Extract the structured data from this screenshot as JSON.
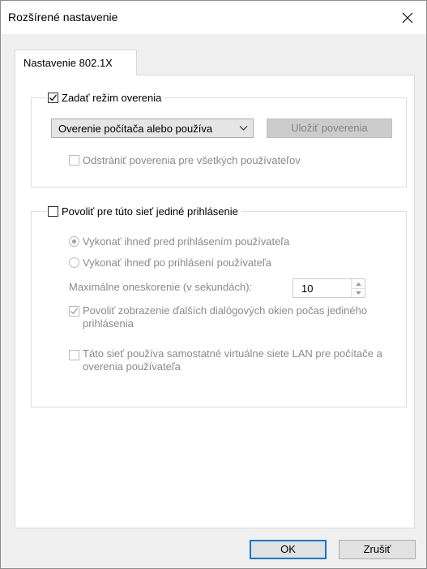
{
  "window": {
    "title": "Rozšírené nastavenie"
  },
  "tabs": [
    {
      "label": "Nastavenie 802.1X",
      "selected": true
    }
  ],
  "auth_mode_group": {
    "checkbox_label": "Zadať režim overenia",
    "checked": true,
    "mode_select": {
      "selected": "Overenie počítača alebo používa",
      "icon": "chevron-down-icon"
    },
    "save_credentials_label": "Uložiť poverenia",
    "remove_credentials_label": "Odstrániť poverenia pre všetkých používateľov",
    "remove_credentials_checked": false
  },
  "sso_group": {
    "checkbox_label": "Povoliť pre túto sieť jediné prihlásenie",
    "checked": false,
    "radio_before_label": "Vykonať ihneď pred prihlásením používateľa",
    "radio_before_selected": true,
    "radio_after_label": "Vykonať ihneď po prihlásení používateľa",
    "radio_after_selected": false,
    "max_delay_label": "Maximálne oneskorenie (v sekundách):",
    "max_delay_value": "10",
    "allow_dialogs_label": "Povoliť zobrazenie ďalších dialógových okien počas jediného prihlásenia",
    "allow_dialogs_checked": true,
    "separate_vlan_label": "Táto sieť používa samostatné virtuálne siete LAN pre počítače a overenia používateľa",
    "separate_vlan_checked": false
  },
  "buttons": {
    "ok_label": "OK",
    "cancel_label": "Zrušiť"
  },
  "colors": {
    "accent": "#0078d7",
    "disabled_text": "#8a8a8a",
    "dialog_bg": "#f0f0f0"
  }
}
